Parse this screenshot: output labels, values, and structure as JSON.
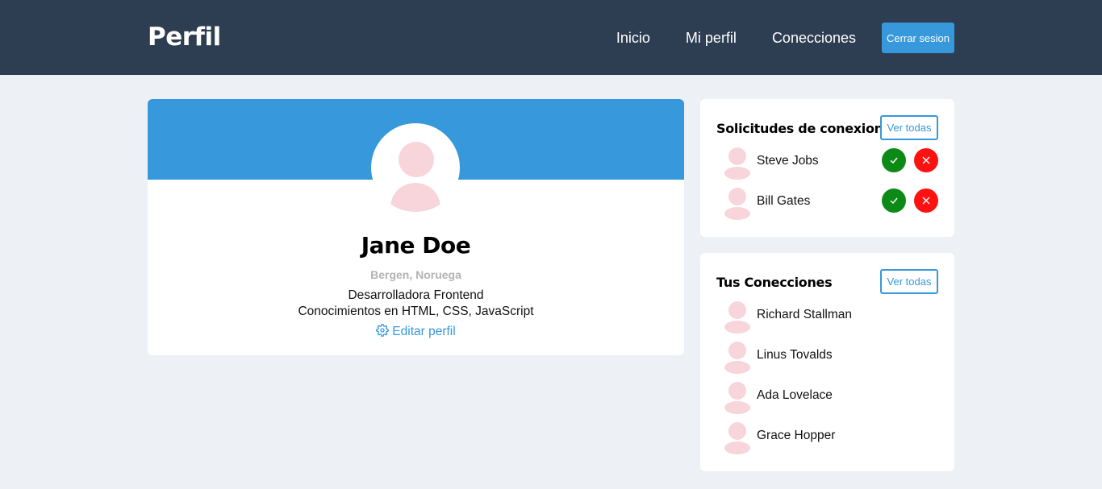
{
  "navbar": {
    "brand": "Perfil",
    "links": [
      "Inicio",
      "Mi perfil",
      "Conecciones"
    ],
    "logout_label": "Cerrar sesion"
  },
  "profile": {
    "name": "Jane Doe",
    "location": "Bergen, Noruega",
    "bio_line1": "Desarrolladora Frontend",
    "bio_line2": "Conocimientos en HTML, CSS, JavaScript",
    "edit_label": "Editar perfil"
  },
  "requests": {
    "title": "Solicitudes de conexion",
    "view_all": "Ver todas",
    "items": [
      {
        "name": "Steve Jobs"
      },
      {
        "name": "Bill Gates"
      }
    ]
  },
  "connections": {
    "title": "Tus Conecciones",
    "view_all": "Ver todas",
    "items": [
      {
        "name": "Richard Stallman"
      },
      {
        "name": "Linus Tovalds"
      },
      {
        "name": "Ada Lovelace"
      },
      {
        "name": "Grace Hopper"
      }
    ]
  },
  "colors": {
    "navbar_bg": "#2d3e52",
    "accent": "#3798db",
    "page_bg": "#edf0f4",
    "accept": "#0c8a16",
    "reject": "#ff1111",
    "avatar": "#f7d5db"
  }
}
